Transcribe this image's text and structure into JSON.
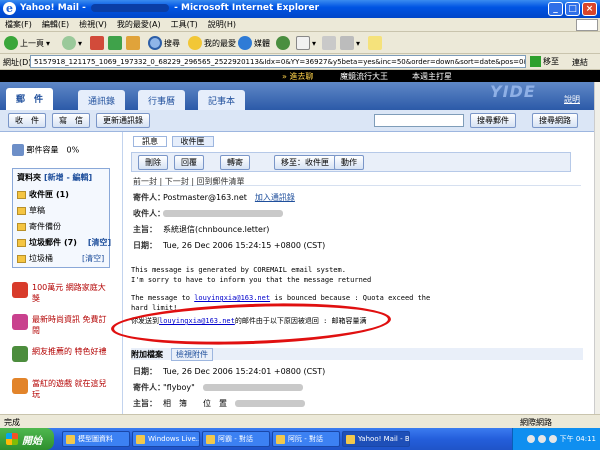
{
  "window": {
    "title_left": "Yahoo! Mail -",
    "title_right": "- Microsoft Internet Explorer",
    "ie_icon": "e"
  },
  "menu": [
    "檔案(F)",
    "編輯(E)",
    "檢視(V)",
    "我的最愛(A)",
    "工具(T)",
    "說明(H)"
  ],
  "toolbar": {
    "back": "上一頁",
    "search": "搜尋",
    "favorites": "我的最愛",
    "media": "媒體"
  },
  "address": {
    "label": "網址(D)",
    "value": "5157918_121175_1069_197332_0_68229_296565_2522920113&Idx=0&YY=36927&y5beta=yes&inc=50&order=down&sort=date&pos=0&view=a&head=b&box=Inbox",
    "go": "移至",
    "links": "連結"
  },
  "adstrip": {
    "a": "» 進去聊",
    "b": "魔鏡流行大王",
    "c": "本週主打星"
  },
  "nav": {
    "tab1": "郵　件",
    "tab2": "通訊錄",
    "tab3": "行事曆",
    "tab4": "記事本",
    "logo": "YIDE",
    "help": "說明"
  },
  "actionbar": {
    "check": "收　件",
    "compose": "寫　信",
    "addr": "更新通訊錄",
    "searchmail": "搜尋郵件",
    "searchweb": "搜尋網路"
  },
  "left": {
    "user_line": "郵件容量　0%",
    "folders_title": "資料夾",
    "folders_add": "[新增 - 編輯]",
    "folders": [
      {
        "name": "收件匣",
        "count": "(1)"
      },
      {
        "name": "草稿",
        "count": ""
      },
      {
        "name": "寄件備份",
        "count": ""
      },
      {
        "name": "垃圾郵件",
        "count": "(7)"
      },
      {
        "name": "垃圾桶",
        "count": ""
      }
    ],
    "empty": "[清空]",
    "promos": [
      "100萬元 網路家庭大獎",
      "最新時尚資訊 免費訂閱",
      "網友推薦的 特色好禮",
      "當紅的遊戲 就在這兒玩"
    ]
  },
  "main": {
    "subtabs": [
      "訊息",
      "收件匣"
    ],
    "toolbar": [
      "刪除",
      "回覆",
      "轉寄",
      "移至：收件匣",
      "動作"
    ],
    "navline": "前一封 | 下一封 | 回到郵件清單",
    "from_label": "寄件人：",
    "from_value": "Postmaster@163.net",
    "from_action": "加入通訊錄",
    "to_label": "收件人：",
    "sub_label": "主旨：",
    "sub_value": "系統退信(chnbounce.letter)",
    "date_label": "日期：",
    "date_value": "Tue, 26 Dec 2006 15:24:15 +0800 (CST)",
    "body1": "This message is generated by COREMAIL email system.",
    "body2": "I'm sorry to have to inform you that the message returned",
    "body3_pre": "The message to ",
    "body3_link": "louyingxia@163.net",
    "body3_post": " is bounced because : Quota exceed the",
    "body4": "hard limit!",
    "body5_pre": "你发送到",
    "body5_link": "louyingxia@163.net",
    "body5_post": "的邮件由于以下原因被退回 : 邮箱容量满",
    "att_label": "附加檔案",
    "att_view": "檢視附件",
    "date2_value": "Tue, 26 Dec 2006 15:24:01 +0800 (CST)",
    "from2_value": "\"flyboy\"",
    "subject2_value": "相　簿　　位　置"
  },
  "status": {
    "text": "完成",
    "zone": "網際網路"
  },
  "taskbar": {
    "start": "開始",
    "tasks": [
      "模型圖資料",
      "Windows Live...",
      "阿霸 - 對話",
      "阿阮 - 對話",
      "Yahoo! Mail - B..."
    ],
    "clock": "下午 04:11"
  }
}
